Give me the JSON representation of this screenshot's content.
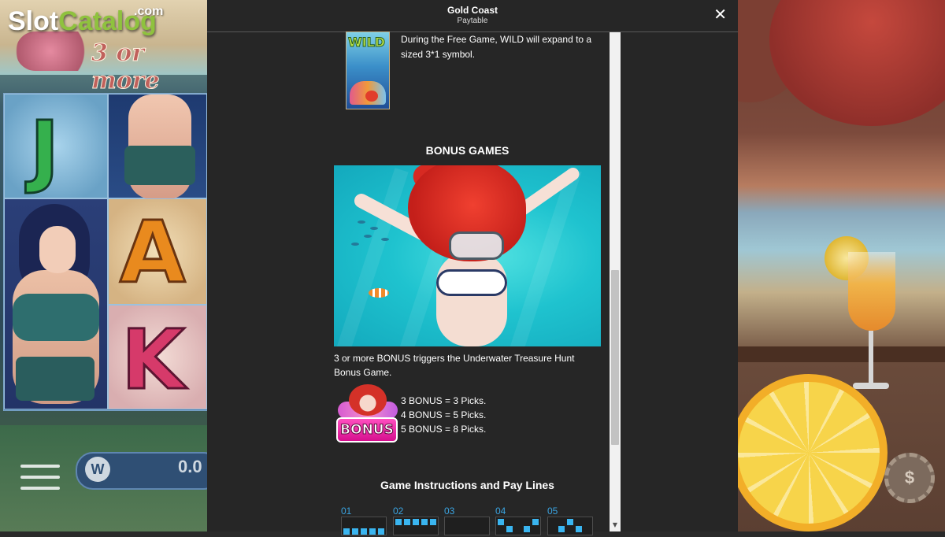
{
  "watermark": {
    "brand_part1": "Slot",
    "brand_part2": "Catalog",
    "brand_suffix": ".com"
  },
  "background_game": {
    "banner_text": "3 or more",
    "reel_symbols": [
      "J",
      "A",
      "K"
    ],
    "balance_value": "0.0",
    "balance_icon": "W",
    "chip_symbol": "$"
  },
  "modal": {
    "title": "Gold Coast",
    "subtitle": "Paytable",
    "close_icon": "close-icon"
  },
  "wild": {
    "symbol_label": "WILD",
    "description": "During the Free Game, WILD will expand to a sized 3*1 symbol."
  },
  "bonus_games": {
    "heading": "BONUS GAMES",
    "description": "3 or more BONUS triggers the Underwater Treasure Hunt Bonus Game.",
    "symbol_label": "BONUS",
    "picks": [
      "3 BONUS = 3 Picks.",
      "4 BONUS = 5 Picks.",
      "5 BONUS = 8 Picks."
    ]
  },
  "instructions": {
    "heading": "Game Instructions and Pay Lines",
    "paylines": [
      {
        "number": "01"
      },
      {
        "number": "02"
      },
      {
        "number": "03"
      },
      {
        "number": "04"
      },
      {
        "number": "05"
      }
    ]
  },
  "colors": {
    "modal_bg": "#262626",
    "accent_blue": "#3ab5f0",
    "brand_green": "#8fc23e"
  }
}
